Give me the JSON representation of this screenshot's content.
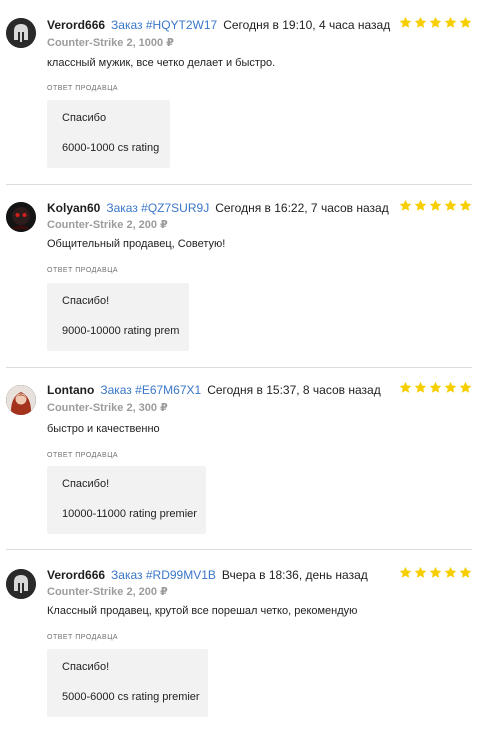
{
  "colors": {
    "star": "#f7ce00",
    "order_link": "#3a77c9",
    "reply_bg": "#f2f2f2"
  },
  "reviews": [
    {
      "avatar": "helmet-icon",
      "user": "Verord666",
      "order": "Заказ #HQYT2W17",
      "date": "Сегодня в 19:10, 4 часа назад",
      "game": "Counter-Strike 2, 1000 ₽",
      "text": "классный мужик, все четко делает и быстро.",
      "reply_label": "ОТВЕТ ПРОДАВЦА",
      "reply_lines": [
        "Спасибо",
        "6000-1000 cs rating"
      ],
      "stars": 5
    },
    {
      "avatar": "dark-hooded-avatar",
      "user": "Kolyan60",
      "order": "Заказ #QZ7SUR9J",
      "date": "Сегодня в 16:22, 7 часов назад",
      "game": "Counter-Strike 2, 200 ₽",
      "text": "Общительный продавец, Советую!",
      "reply_label": "ОТВЕТ ПРОДАВЦА",
      "reply_lines": [
        "Спасибо!",
        "9000-10000 rating prem"
      ],
      "stars": 5
    },
    {
      "avatar": "redhead-avatar",
      "user": "Lontano",
      "order": "Заказ #E67M67X1",
      "date": "Сегодня в 15:37, 8 часов назад",
      "game": "Counter-Strike 2, 300 ₽",
      "text": "быстро и качественно",
      "reply_label": "ОТВЕТ ПРОДАВЦА",
      "reply_lines": [
        "Спасибо!",
        "10000-11000 rating premier"
      ],
      "stars": 5
    },
    {
      "avatar": "helmet-icon",
      "user": "Verord666",
      "order": "Заказ #RD99MV1B",
      "date": "Вчера в 18:36, день назад",
      "game": "Counter-Strike 2, 200 ₽",
      "text": "Классный продавец, крутой все порешал четко, рекомендую",
      "reply_label": "ОТВЕТ ПРОДАВЦА",
      "reply_lines": [
        "Спасибо!",
        "5000-6000 cs rating premier"
      ],
      "stars": 5
    }
  ]
}
